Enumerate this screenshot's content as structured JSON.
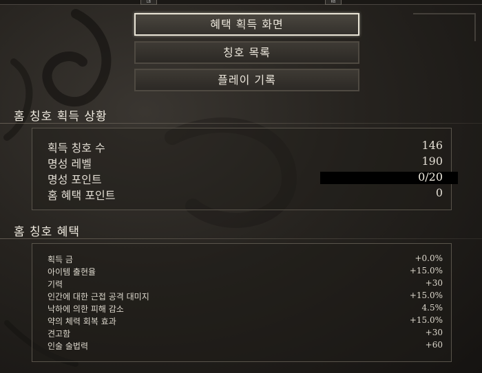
{
  "controller": {
    "lb": "LB",
    "rb": "RB"
  },
  "menu": {
    "benefit_screen": "혜택 획득 화면",
    "title_list": "칭호 목록",
    "play_record": "플레이 기록"
  },
  "status": {
    "heading": "홈 칭호 획득 상황",
    "rows": [
      {
        "label": "획득 칭호 수",
        "value": "146"
      },
      {
        "label": "명성 레벨",
        "value": "190"
      },
      {
        "label": "명성 포인트",
        "value": "0/20"
      },
      {
        "label": "홈 혜택 포인트",
        "value": "0"
      }
    ],
    "fame_progress_fraction": 0
  },
  "benefits": {
    "heading": "홈 칭호 혜택",
    "rows": [
      {
        "label": "획득 금",
        "value": "+0.0%"
      },
      {
        "label": "아이템 출현율",
        "value": "+15.0%"
      },
      {
        "label": "기력",
        "value": "+30"
      },
      {
        "label": "인간에 대한 근접 공격 대미지",
        "value": "+15.0%"
      },
      {
        "label": "낙하에 의한 피해 감소",
        "value": "4.5%"
      },
      {
        "label": "약의 체력 회복 효과",
        "value": "+15.0%"
      },
      {
        "label": "견고함",
        "value": "+30"
      },
      {
        "label": "인술 술법력",
        "value": "+60"
      }
    ]
  },
  "colors": {
    "background": "#26231f",
    "panel_border": "#5a554c",
    "active_border": "#e9e4d6",
    "text": "#e2ddd3"
  }
}
